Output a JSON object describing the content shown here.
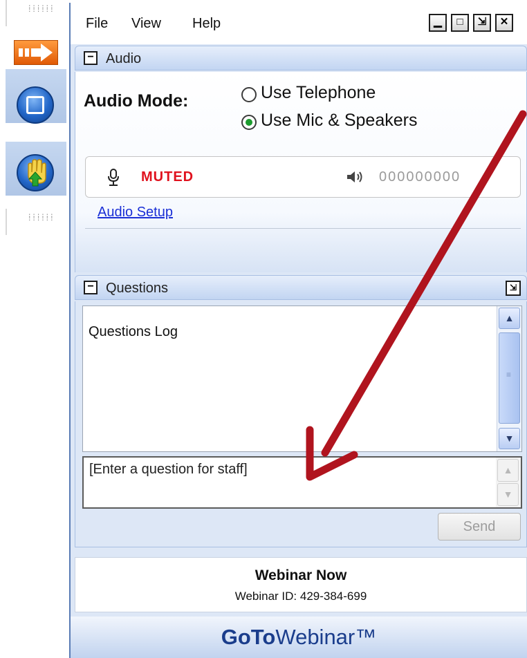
{
  "menu": {
    "items": [
      "File",
      "View",
      "Help"
    ]
  },
  "window_controls": {
    "minimize": "▁",
    "restore": "□",
    "detach": "⇲",
    "close": "✕"
  },
  "sidebar": {
    "buttons": [
      {
        "name": "collapse-arrow-icon",
        "color": "#f06a12"
      },
      {
        "name": "stop-square-icon",
        "color": "#2266c8"
      },
      {
        "name": "raise-hand-icon",
        "color": "#2266c8"
      }
    ]
  },
  "audio": {
    "header": "Audio",
    "mode_label": "Audio Mode:",
    "options": [
      {
        "label": "Use Telephone",
        "selected": false
      },
      {
        "label": "Use Mic & Speakers",
        "selected": true
      }
    ],
    "mic_status": "MUTED",
    "speaker_level": "000000000",
    "setup_link": "Audio Setup"
  },
  "questions": {
    "header": "Questions",
    "log_label": "Questions Log",
    "input_placeholder": "[Enter a question for staff]",
    "send_label": "Send"
  },
  "footer": {
    "title": "Webinar Now",
    "webinar_id": "Webinar ID: 429-384-699",
    "brand_bold": "GoTo",
    "brand_light": "Webinar™"
  },
  "colors": {
    "muted": "#e0121e",
    "link": "#1a2fd6",
    "annotation_arrow": "#b0141e",
    "selected_radio": "#1c9b2e"
  }
}
